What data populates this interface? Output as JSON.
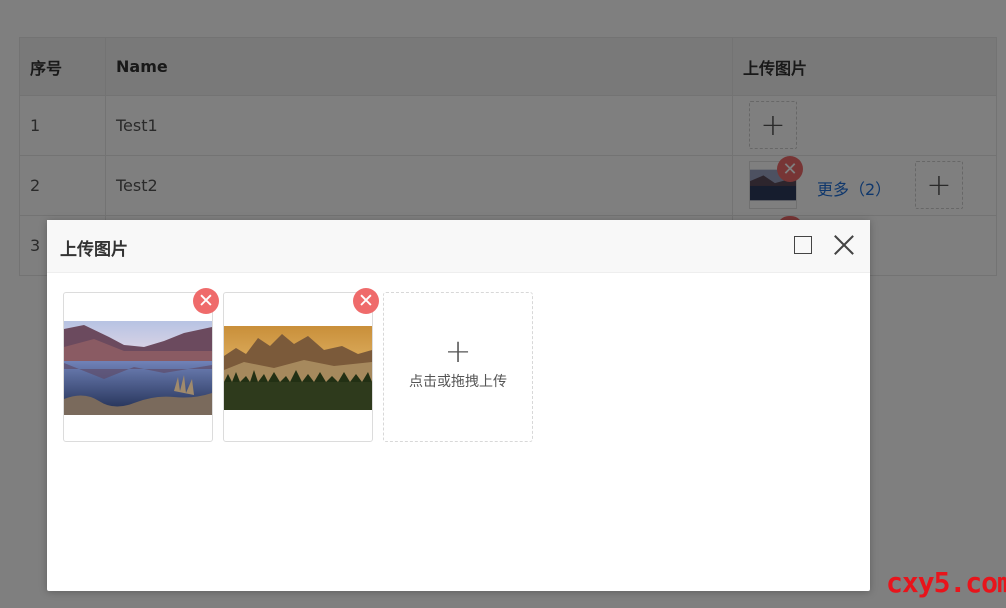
{
  "table": {
    "headers": [
      "序号",
      "Name",
      "上传图片"
    ],
    "rows": [
      {
        "index": "1",
        "name": "Test1"
      },
      {
        "index": "2",
        "name": "Test2",
        "more_link": "更多（2）"
      },
      {
        "index": "3",
        "name": ""
      }
    ],
    "add_icon": "plus-icon",
    "delete_icon": "close-circle-icon"
  },
  "modal": {
    "title": "上传图片",
    "maximize_icon": "maximize-icon",
    "close_icon": "close-icon",
    "images": [
      {
        "alt": "lake-landscape-image"
      },
      {
        "alt": "mountain-landscape-image"
      }
    ],
    "upload": {
      "icon": "plus-icon",
      "text": "点击或拖拽上传"
    }
  },
  "colors": {
    "delete_badge": "#ef6b6b",
    "link": "#1e6fd9",
    "watermark": "#e8141b"
  },
  "watermark": "cxy5.com"
}
